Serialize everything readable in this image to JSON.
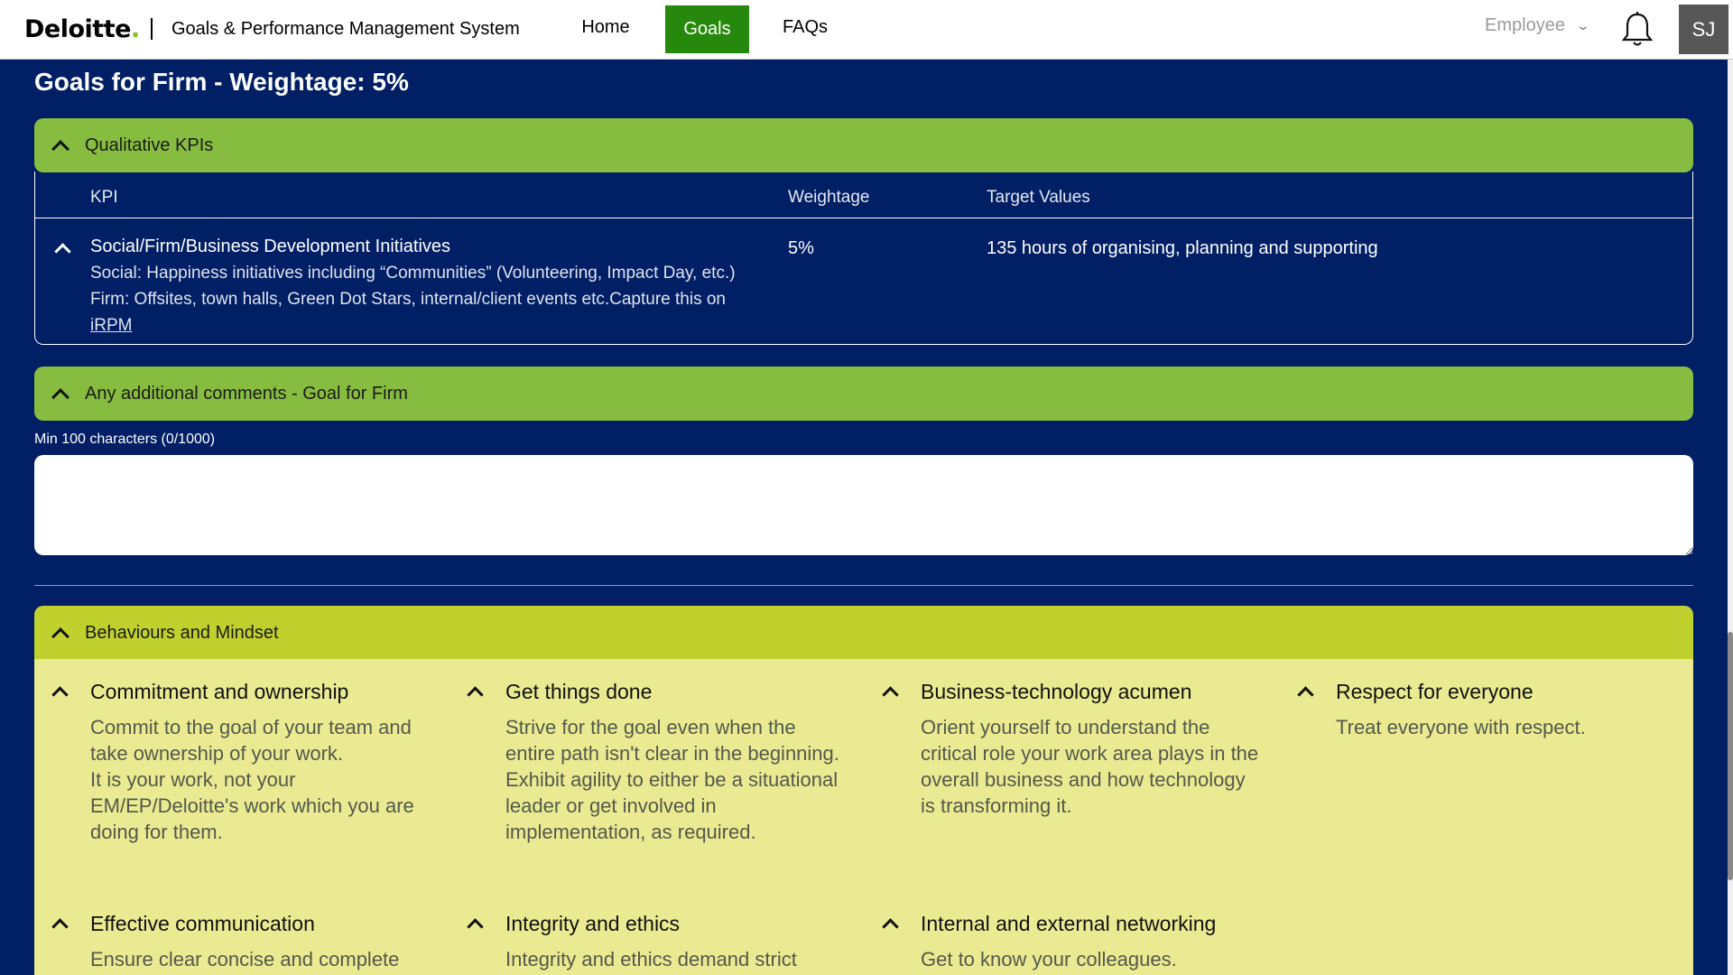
{
  "header": {
    "logo_text": "Deloitte",
    "logo_dot": ".",
    "app_title": "Goals & Performance Management System",
    "nav": [
      {
        "label": "Home"
      },
      {
        "label": "Goals"
      },
      {
        "label": "FAQs"
      }
    ],
    "role_selected": "Employee",
    "avatar_initials": "SJ",
    "colors": {
      "active_nav": "#26890d",
      "brand_dot": "#86bc25"
    }
  },
  "section": {
    "title": "Goals for Firm - Weightage: 5%"
  },
  "qualitative": {
    "panel_label": "Qualitative KPIs",
    "columns": [
      "KPI",
      "Weightage",
      "Target Values"
    ],
    "rows": [
      {
        "name": "Social/Firm/Business Development Initiatives",
        "desc_line1": "Social: Happiness initiatives including “Communities” (Volunteering, Impact Day, etc.)",
        "desc_line2": "Firm: Offsites, town halls, Green Dot Stars, internal/client events etc.Capture this on",
        "link": "iRPM",
        "weightage": "5%",
        "target": "135 hours of organising, planning and supporting"
      }
    ]
  },
  "comments": {
    "panel_label": "Any additional comments - Goal for Firm",
    "hint": "Min 100 characters (0/1000)",
    "value": ""
  },
  "behaviours": {
    "panel_label": "Behaviours and Mindset",
    "items": [
      {
        "title": "Commitment and ownership",
        "desc": "Commit to the goal of your team and take ownership of your work.\nIt is your work, not your EM/EP/Deloitte's work which you are doing for them."
      },
      {
        "title": "Get things done",
        "desc": "Strive for the goal even when the entire path isn't clear in the beginning.\nExhibit agility to either be a situational leader or get involved in implementation, as required."
      },
      {
        "title": "Business-technology acumen",
        "desc": "Orient yourself to understand the critical role your work area plays in the overall business and how technology is transforming it."
      },
      {
        "title": "Respect for everyone",
        "desc": "Treat everyone with respect."
      },
      {
        "title": "Effective communication",
        "desc": "Ensure clear concise and complete"
      },
      {
        "title": "Integrity and ethics",
        "desc": "Integrity and ethics demand strict"
      },
      {
        "title": "Internal and external networking",
        "desc": "Get to know your colleagues."
      }
    ]
  }
}
